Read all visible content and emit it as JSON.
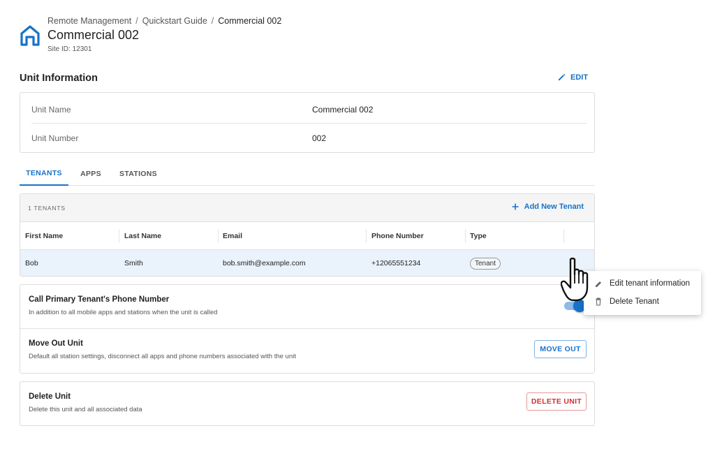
{
  "header": {
    "breadcrumb": [
      "Remote Management",
      "Quickstart Guide",
      "Commercial 002"
    ],
    "separator": "/",
    "title": "Commercial 002",
    "site_id": "Site ID: 12301",
    "logo_icon": "house-icon"
  },
  "unit_info": {
    "section_title": "Unit Information",
    "edit_label": "EDIT",
    "edit_icon": "pencil-icon",
    "rows": [
      {
        "label": "Unit Name",
        "value": "Commercial 002"
      },
      {
        "label": "Unit Number",
        "value": "002"
      }
    ]
  },
  "tabs": [
    {
      "label": "TENANTS",
      "active": true
    },
    {
      "label": "APPS",
      "active": false
    },
    {
      "label": "STATIONS",
      "active": false
    }
  ],
  "tenants": {
    "count_label": "1 TENANTS",
    "add_label": "Add New Tenant",
    "add_icon": "plus-icon",
    "columns": [
      "First Name",
      "Last Name",
      "Email",
      "Phone Number",
      "Type"
    ],
    "rows": [
      {
        "first_name": "Bob",
        "last_name": "Smith",
        "email": "bob.smith@example.com",
        "phone": "+12065551234",
        "type": "Tenant"
      }
    ]
  },
  "settings": {
    "call_primary": {
      "title": "Call Primary Tenant's Phone Number",
      "description": "In addition to all mobile apps and stations when the unit is called",
      "enabled": true
    },
    "move_out": {
      "title": "Move Out Unit",
      "description": "Default all station settings, disconnect all apps and phone numbers associated with the unit",
      "button": "MOVE OUT"
    },
    "delete_unit": {
      "title": "Delete Unit",
      "description": "Delete this unit and all associated data",
      "button": "DELETE UNIT"
    }
  },
  "context_menu": {
    "items": [
      {
        "label": "Edit tenant information",
        "icon": "pencil-icon"
      },
      {
        "label": "Delete Tenant",
        "icon": "trash-icon"
      }
    ]
  },
  "colors": {
    "accent": "#1673c9",
    "danger": "#d32f2f",
    "row_highlight": "#eaf2fb"
  }
}
